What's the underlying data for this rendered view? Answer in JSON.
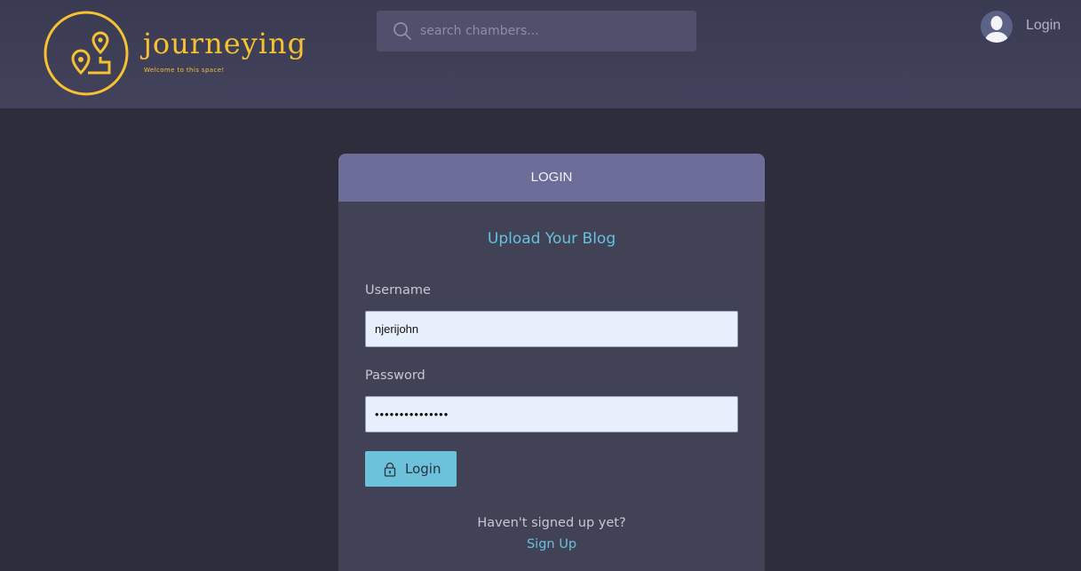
{
  "brand": {
    "name": "journeying",
    "tagline": "Welcome to this space!",
    "accent_color": "#f6c232",
    "logo_icon": "map-pin-route-icon"
  },
  "search": {
    "placeholder": "search chambers...",
    "value": "",
    "icon": "search-icon"
  },
  "nav": {
    "avatar_icon": "user-avatar-icon",
    "login_label": "Login"
  },
  "login_card": {
    "header_title": "LOGIN",
    "subtitle": "Upload Your Blog",
    "username_label": "Username",
    "username_value": "njerijohn",
    "password_label": "Password",
    "password_value": "•••••••••••••••",
    "submit_label": "Login",
    "submit_icon": "lock-icon",
    "signup_prompt": "Haven't signed up yet?",
    "signup_link": "Sign Up"
  },
  "colors": {
    "page_background": "#2d2d3b",
    "header_background": "#3d3d55",
    "card_header": "#6d6d9a",
    "card_body": "#424257",
    "link_accent": "#66c1dd",
    "button": "#6bc2da"
  }
}
